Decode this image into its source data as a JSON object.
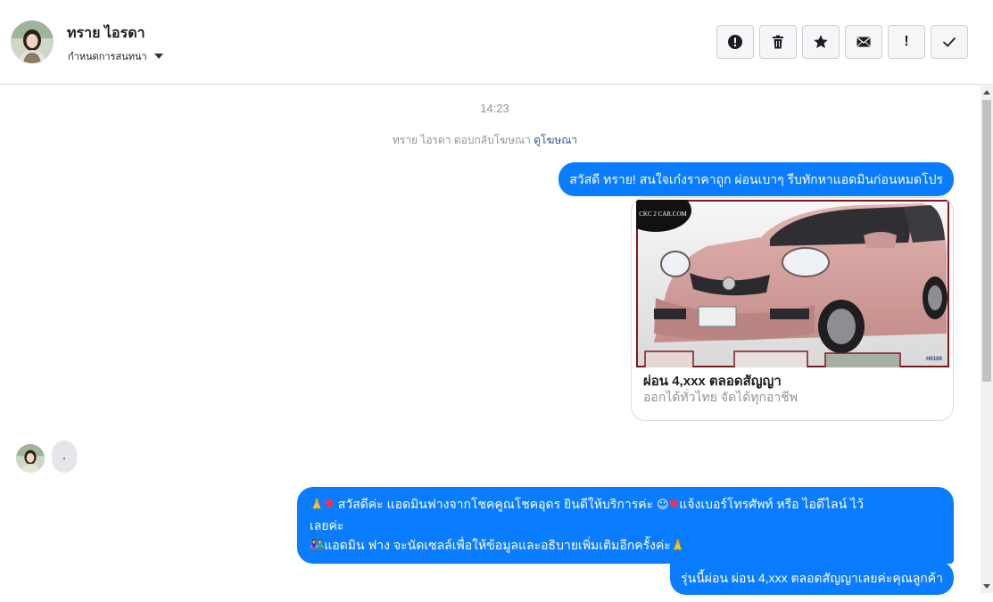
{
  "header": {
    "contact_name": "ทราย ไอรดา",
    "assign_label": "กำหนดการสนทนา",
    "actions": [
      {
        "icon": "alert-circle-icon",
        "label": "spam"
      },
      {
        "icon": "trash-icon",
        "label": "delete"
      },
      {
        "icon": "star-icon",
        "label": "follow-up"
      },
      {
        "icon": "envelope-icon",
        "label": "mark-unread"
      },
      {
        "icon": "exclamation-icon",
        "label": "!"
      },
      {
        "icon": "check-icon",
        "label": "done"
      }
    ]
  },
  "conversation": {
    "timestamp": "14:23",
    "ad_reply_text": "ทราย ไอรดา ตอบกลับโฆษณา",
    "ad_reply_link": "ดูโฆษณา",
    "messages": {
      "greeting": "สวัสดี ทราย! สนใจเก๋งราคาถูก ผ่อนเบาๆ รีบทักหาแอดมินก่อนหมดโปร",
      "ad_card": {
        "watermark": "CKC 2 CAR.COM",
        "plate_tag": "H0100",
        "title": "ผ่อน 4,xxx ตลอดสัญญา",
        "subtitle": "ออกได้ทั่วไทย จัดได้ทุกอาชีพ"
      },
      "incoming": ".",
      "admin_intro_line1": "สวัสดีค่ะ แอดมินฟางจากโชคคูณโชคอุดร ยินดีให้บริการค่ะ",
      "admin_intro_line1b": "แจ้งเบอร์โทรศัพท์ หรือ ไอดีไลน์  ไว้",
      "admin_intro_line2": "เลยค่ะ",
      "admin_intro_line3": "แอดมิน ฟาง จะนัดเซลล์เพื่อให้ข้อมูลและอธิบายเพิ่มเติมอีกครั้งค่ะ",
      "price_note": "รุ่นนี้ผ่อน ผ่อน 4,xxx ตลอดสัญญาเลยค่ะคุณลูกค้า"
    }
  },
  "colors": {
    "outgoing_bubble": "#0a7cff",
    "incoming_bubble": "#e4e6eb",
    "meta_text": "#90949c",
    "link": "#385898"
  }
}
